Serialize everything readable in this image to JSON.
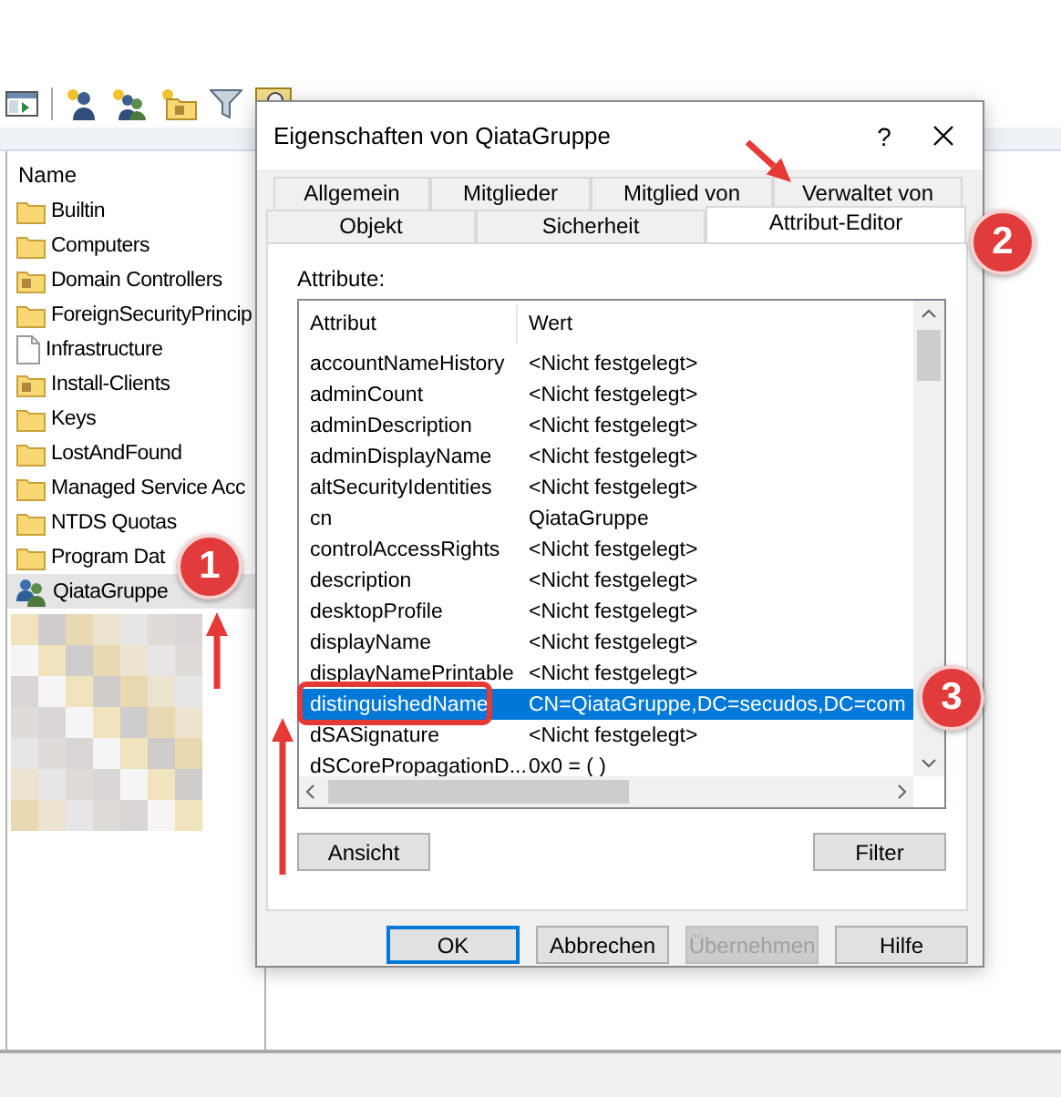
{
  "tree_pane": {
    "column_header": "Name",
    "items": [
      {
        "label": "Builtin",
        "kind": "folder",
        "selected": false
      },
      {
        "label": "Computers",
        "kind": "folder",
        "selected": false
      },
      {
        "label": "Domain Controllers",
        "kind": "ou",
        "selected": false
      },
      {
        "label": "ForeignSecurityPrincip",
        "kind": "folder",
        "selected": false
      },
      {
        "label": "Infrastructure",
        "kind": "document",
        "selected": false
      },
      {
        "label": "Install-Clients",
        "kind": "ou",
        "selected": false
      },
      {
        "label": "Keys",
        "kind": "folder",
        "selected": false
      },
      {
        "label": "LostAndFound",
        "kind": "folder",
        "selected": false
      },
      {
        "label": "Managed Service Acc",
        "kind": "folder",
        "selected": false
      },
      {
        "label": "NTDS Quotas",
        "kind": "folder",
        "selected": false
      },
      {
        "label": "Program Dat",
        "kind": "folder",
        "selected": false
      },
      {
        "label": "QiataGruppe",
        "kind": "group",
        "selected": true
      }
    ]
  },
  "dialog": {
    "title": "Eigenschaften von QiataGruppe",
    "help": "?",
    "tab_rows": [
      {
        "tabs": [
          {
            "label": "Allgemein",
            "selected": false
          },
          {
            "label": "Mitglieder",
            "selected": false
          },
          {
            "label": "Mitglied von",
            "selected": false
          },
          {
            "label": "Verwaltet von",
            "selected": false
          }
        ]
      },
      {
        "tabs": [
          {
            "label": "Objekt",
            "selected": false
          },
          {
            "label": "Sicherheit",
            "selected": false
          },
          {
            "label": "Attribut-Editor",
            "selected": true
          }
        ]
      }
    ],
    "attribute_label": "Attribute:",
    "attribute_table": {
      "columns": [
        "Attribut",
        "Wert"
      ],
      "rows": [
        {
          "attribute": "accountNameHistory",
          "value": "<Nicht festgelegt>",
          "selected": false
        },
        {
          "attribute": "adminCount",
          "value": "<Nicht festgelegt>",
          "selected": false
        },
        {
          "attribute": "adminDescription",
          "value": "<Nicht festgelegt>",
          "selected": false
        },
        {
          "attribute": "adminDisplayName",
          "value": "<Nicht festgelegt>",
          "selected": false
        },
        {
          "attribute": "altSecurityIdentities",
          "value": "<Nicht festgelegt>",
          "selected": false
        },
        {
          "attribute": "cn",
          "value": "QiataGruppe",
          "selected": false
        },
        {
          "attribute": "controlAccessRights",
          "value": "<Nicht festgelegt>",
          "selected": false
        },
        {
          "attribute": "description",
          "value": "<Nicht festgelegt>",
          "selected": false
        },
        {
          "attribute": "desktopProfile",
          "value": "<Nicht festgelegt>",
          "selected": false
        },
        {
          "attribute": "displayName",
          "value": "<Nicht festgelegt>",
          "selected": false
        },
        {
          "attribute": "displayNamePrintable",
          "value": "<Nicht festgelegt>",
          "selected": false
        },
        {
          "attribute": "distinguishedName",
          "value": "CN=QiataGruppe,DC=secudos,DC=com",
          "selected": true
        },
        {
          "attribute": "dSASignature",
          "value": "<Nicht festgelegt>",
          "selected": false
        },
        {
          "attribute": "dSCorePropagationD...",
          "value": "0x0 = (  )",
          "selected": false
        }
      ]
    },
    "panel_buttons": [
      {
        "label": "Ansicht"
      },
      {
        "label": "Filter"
      }
    ],
    "buttons": [
      {
        "label": "OK",
        "default": true,
        "disabled": false
      },
      {
        "label": "Abbrechen",
        "default": false,
        "disabled": false
      },
      {
        "label": "Übernehmen",
        "default": false,
        "disabled": true
      },
      {
        "label": "Hilfe",
        "default": false,
        "disabled": false
      }
    ]
  },
  "annotations": {
    "badges": [
      "1",
      "2",
      "3"
    ]
  }
}
